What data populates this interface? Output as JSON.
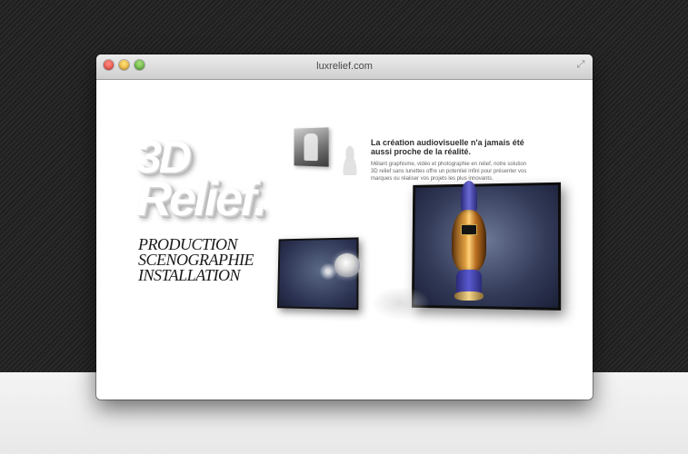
{
  "window": {
    "title": "luxrelief.com"
  },
  "logo": {
    "line1": "3D",
    "line2": "Relief."
  },
  "services": [
    "PRODUCTION",
    "SCENOGRAPHIE",
    "INSTALLATION"
  ],
  "intro": {
    "headline": "La création audiovisuelle n'a jamais été aussi proche de la réalité.",
    "body": "Mêlant graphisme, vidéo et photographie en relief, notre solution 3D relief sans lunettes offre un potentiel infini pour présenter vos marques ou réaliser vos projets les plus innovants."
  },
  "colors": {
    "background": "#242424",
    "window": "#ffffff",
    "titlebar": "#d9d9d9"
  }
}
